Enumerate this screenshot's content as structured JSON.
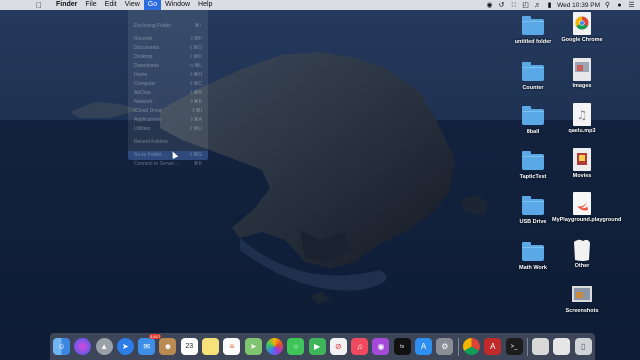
{
  "menubar": {
    "items": [
      "Finder",
      "File",
      "Edit",
      "View",
      "Go",
      "Window",
      "Help"
    ],
    "active": "Go",
    "clock": "Wed 10:39 PM"
  },
  "go_menu": {
    "items": [
      "Enclosing Folder",
      "Recents",
      "Documents",
      "Desktop",
      "Downloads",
      "Home",
      "Computer",
      "AirDrop",
      "Network",
      "iCloud Drive",
      "Applications",
      "Utilities",
      "Recent Folders",
      "Go to Folder…",
      "Connect to Server…"
    ],
    "shortcuts": [
      "⌘↑",
      "⇧⌘F",
      "⇧⌘O",
      "⇧⌘D",
      "⌥⌘L",
      "⇧⌘H",
      "⇧⌘C",
      "⇧⌘R",
      "⇧⌘K",
      "⇧⌘I",
      "⇧⌘A",
      "⇧⌘U",
      "",
      "⇧⌘G",
      "⌘K"
    ]
  },
  "desktop_icons": [
    {
      "label": "untitled folder",
      "kind": "folder",
      "icon": "folder-icon"
    },
    {
      "label": "Google Chrome",
      "kind": "app",
      "icon": "chrome-icon"
    },
    {
      "label": "Counter",
      "kind": "folder",
      "icon": "folder-icon"
    },
    {
      "label": "Images",
      "kind": "doc",
      "icon": "image-file-icon"
    },
    {
      "label": "8ball",
      "kind": "folder",
      "icon": "folder-icon"
    },
    {
      "label": "qaelu.mp3",
      "kind": "audio",
      "icon": "music-file-icon"
    },
    {
      "label": "TapticTest",
      "kind": "folder",
      "icon": "folder-icon"
    },
    {
      "label": "Movies",
      "kind": "doc",
      "icon": "movie-file-icon"
    },
    {
      "label": "USB Drive",
      "kind": "folder",
      "icon": "folder-icon"
    },
    {
      "label": "MyPlayground.playground",
      "kind": "swift",
      "icon": "swift-playground-icon"
    },
    {
      "label": "Math Work",
      "kind": "folder",
      "icon": "folder-icon"
    },
    {
      "label": "Other",
      "kind": "doc",
      "icon": "document-icon"
    },
    {
      "label": "Screenshots",
      "kind": "doc",
      "icon": "screenshots-icon"
    }
  ],
  "dock": {
    "icons": [
      "finder-icon",
      "siri-icon",
      "launchpad-icon",
      "safari-icon",
      "mail-icon",
      "contacts-icon",
      "calendar-icon",
      "notes-icon",
      "reminders-icon",
      "maps-icon",
      "photos-icon",
      "messages-icon",
      "facetime-icon",
      "news-icon",
      "music-icon",
      "podcasts-icon",
      "tv-icon",
      "app-store-icon",
      "system-preferences-icon",
      "chrome-icon",
      "acrobat-icon",
      "terminal-icon",
      "preview-icon",
      "downloads-stack-icon",
      "trash-icon"
    ],
    "calendar_day": "23",
    "mail_badge": "5,617"
  },
  "colors": {
    "menubar": "#ebebf0",
    "menu_active": "#2b6de0",
    "folder": "#5aa9e6",
    "wallpaper_sky": "#1c2f4f",
    "wallpaper_sea": "#0e1d36"
  }
}
